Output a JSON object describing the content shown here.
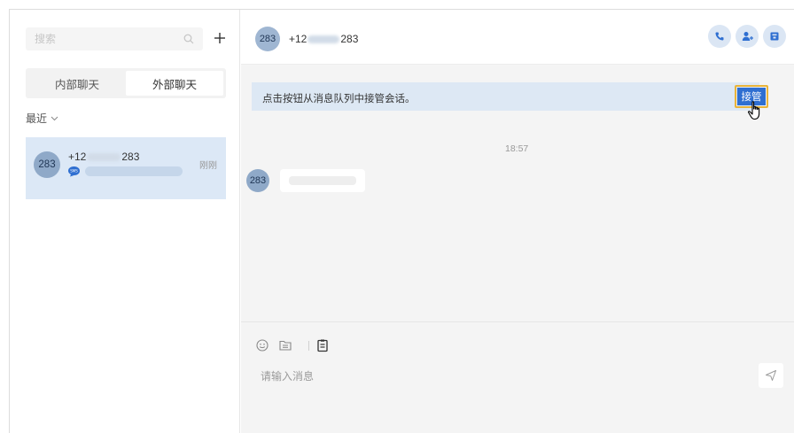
{
  "sidebar": {
    "search": {
      "placeholder": "搜索"
    },
    "tabs": [
      {
        "label": "内部聊天",
        "active": false
      },
      {
        "label": "外部聊天",
        "active": true
      }
    ],
    "recent_label": "最近",
    "conversations": [
      {
        "avatar_text": "283",
        "name_prefix": "+12",
        "name_suffix": "283",
        "time": "刚刚",
        "channel_icon": "sms-icon"
      }
    ]
  },
  "chat": {
    "header": {
      "avatar_text": "283",
      "name_prefix": "+12",
      "name_suffix": "283",
      "actions": [
        "phone-icon",
        "add-contact-icon",
        "archive-icon"
      ]
    },
    "banner": {
      "text": "点击按钮从消息队列中接管会话。",
      "button_label": "接管"
    },
    "messages": [
      {
        "time": "18:57",
        "avatar_text": "283"
      }
    ],
    "composer": {
      "placeholder": "请输入消息",
      "tools": [
        "emoji-icon",
        "file-icon",
        "template-icon"
      ]
    }
  },
  "colors": {
    "accent": "#2f6fd1",
    "highlight_border": "#e9b43a",
    "selected_row": "#dce8f6",
    "banner_bg": "#dde8f4"
  }
}
